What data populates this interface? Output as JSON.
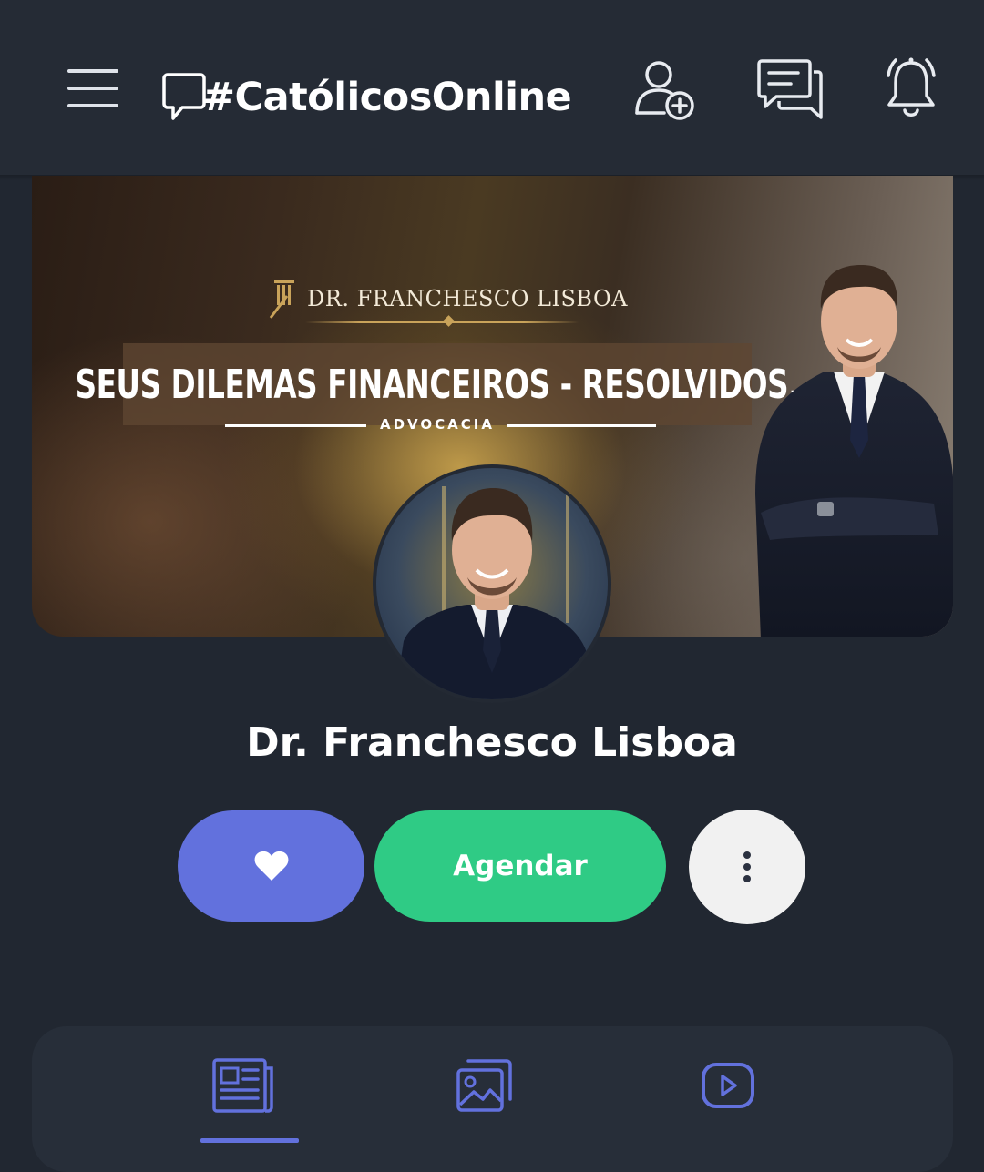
{
  "header": {
    "logo_text": "#CatólicosOnline",
    "menu_icon": "hamburger-menu-icon",
    "add_friend_icon": "add-user-icon",
    "messages_icon": "chat-icon",
    "notifications_icon": "bell-icon"
  },
  "banner": {
    "brand": "DR. FRANCHESCO LISBOA",
    "headline": "SEUS DILEMAS FINANCEIROS - RESOLVIDOS.",
    "subtitle": "ADVOCACIA"
  },
  "profile": {
    "name": "Dr. Franchesco Lisboa"
  },
  "actions": {
    "like_icon": "heart-icon",
    "schedule_label": "Agendar",
    "more_icon": "more-vertical-icon"
  },
  "tabs": [
    {
      "icon": "news-icon",
      "active": true
    },
    {
      "icon": "gallery-icon",
      "active": false
    },
    {
      "icon": "video-icon",
      "active": false
    }
  ],
  "colors": {
    "background": "#212731",
    "header": "#252b35",
    "accent_blue": "#6271dd",
    "accent_green": "#2fcb85",
    "more_button": "#f1f1f1",
    "tab_icon": "#6271dd"
  }
}
